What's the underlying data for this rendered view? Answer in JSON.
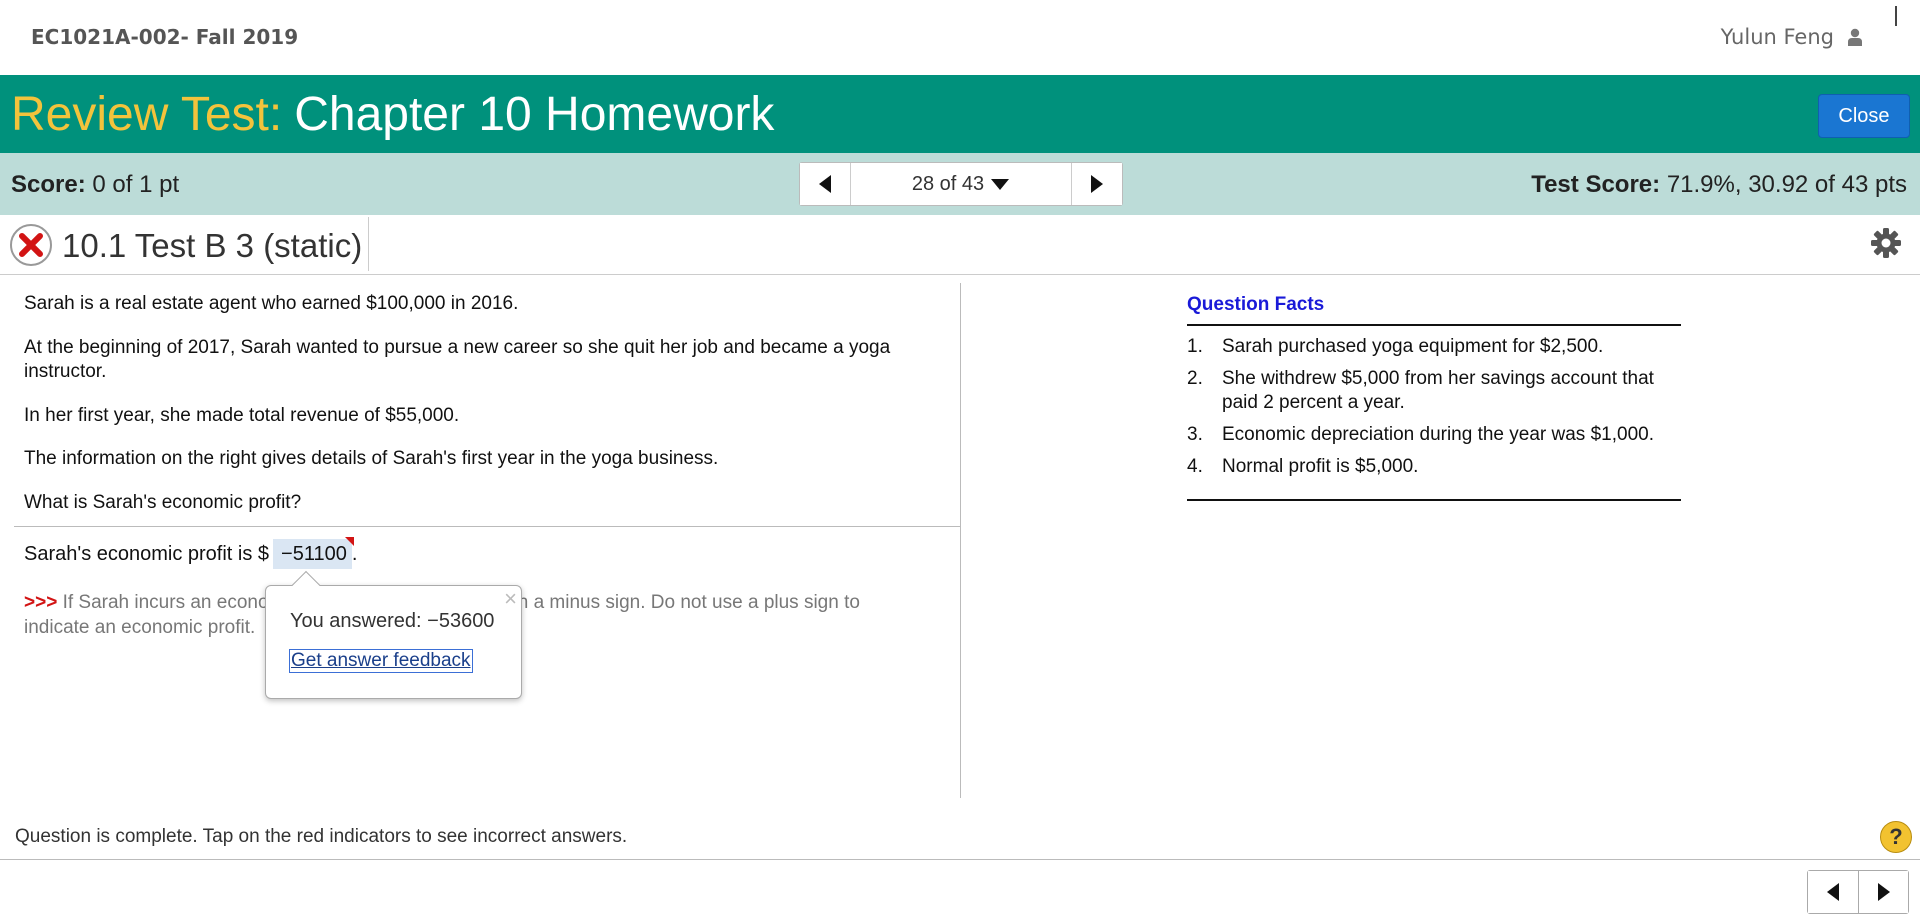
{
  "header": {
    "course": "EC1021A-002- Fall 2019",
    "user_name": "Yulun Feng"
  },
  "banner": {
    "title_prefix": "Review Test:",
    "title_main": "Chapter 10 Homework",
    "close_label": "Close"
  },
  "scorebar": {
    "score_label": "Score:",
    "score_value": "0 of 1 pt",
    "question_position": "28 of 43",
    "test_score_label": "Test Score:",
    "test_score_value": "71.9%, 30.92 of 43 pts"
  },
  "question": {
    "title": "10.1 Test B 3 (static)",
    "paragraphs": [
      "Sarah is a real estate agent who earned $100,000 in 2016.",
      "At the beginning of 2017, Sarah wanted to pursue a new career so she quit her job and became a yoga instructor.",
      "In her first year, she made total revenue of $55,000.",
      "The information on the right gives details of Sarah's first year in the yoga business.",
      "What is Sarah's economic profit?"
    ],
    "answer_prefix": "Sarah's economic profit is $",
    "answer_value": "−51100",
    "answer_suffix": ".",
    "hint_arrows": ">>>",
    "hint_text": " If Sarah incurs an economic loss, enter the answer with a minus sign. Do not use a plus sign to indicate an economic profit."
  },
  "popup": {
    "close_symbol": "×",
    "you_answered": "You answered:  −53600",
    "feedback_link": "Get answer feedback"
  },
  "facts": {
    "title": "Question Facts",
    "items": [
      {
        "num": "1.",
        "text": "Sarah purchased yoga equipment for $2,500."
      },
      {
        "num": "2.",
        "text": "She withdrew $5,000 from her savings account that paid 2 percent a year."
      },
      {
        "num": "3.",
        "text": "Economic depreciation during the year was $1,000."
      },
      {
        "num": "4.",
        "text": "Normal profit is $5,000."
      }
    ]
  },
  "footer": {
    "status": "Question is complete. Tap on the red indicators to see incorrect answers.",
    "help_symbol": "?"
  },
  "colors": {
    "banner": "#00917c",
    "title_prefix": "#f3c33c",
    "scorebar": "#bcdcd8",
    "close_button": "#1a76d2",
    "incorrect": "#d21414",
    "facts_title": "#1a1ad8"
  }
}
